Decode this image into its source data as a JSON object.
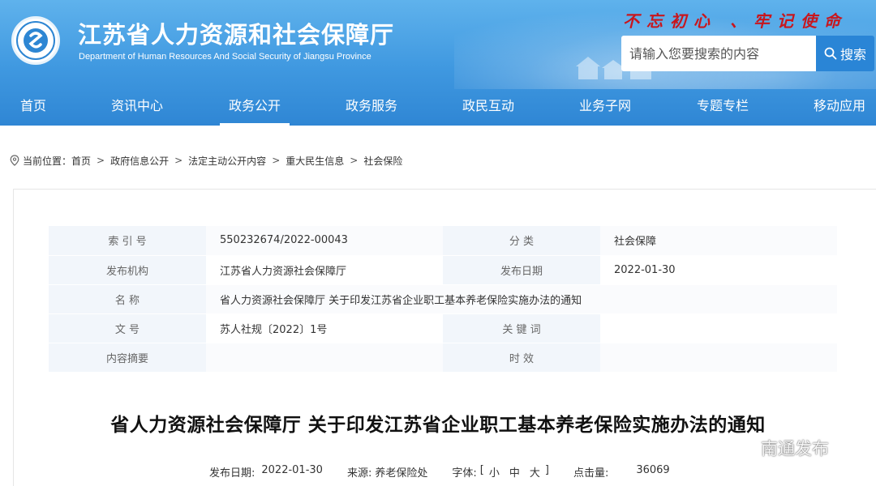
{
  "header": {
    "site_title": "江苏省人力资源和社会保障厅",
    "site_subtitle": "Department of Human Resources And Social Security of Jiangsu Province",
    "slogan": "不忘初心 、牢记使命",
    "search_placeholder": "请输入您要搜索的内容",
    "search_button": "搜索"
  },
  "nav": {
    "items": [
      "首页",
      "资讯中心",
      "政务公开",
      "政务服务",
      "政民互动",
      "业务子网",
      "专题专栏",
      "移动应用"
    ],
    "active": "政务公开"
  },
  "breadcrumb": {
    "prefix": "当前位置：",
    "items": [
      "首页",
      "政府信息公开",
      "法定主动公开内容",
      "重大民生信息",
      "社会保险"
    ]
  },
  "meta": {
    "index_label": "索 引 号",
    "index_value": "550232674/2022-00043",
    "category_label": "分 类",
    "category_value": "社会保障",
    "org_label": "发布机构",
    "org_value": "江苏省人力资源社会保障厅",
    "date_label": "发布日期",
    "date_value": "2022-01-30",
    "name_label": "名 称",
    "name_value": "省人力资源社会保障厅 关于印发江苏省企业职工基本养老保险实施办法的通知",
    "doc_label": "文 号",
    "doc_value": "苏人社规〔2022〕1号",
    "keywords_label": "关 键 词",
    "keywords_value": "",
    "abstract_label": "内容摘要",
    "abstract_value": "",
    "validity_label": "时 效",
    "validity_value": ""
  },
  "article": {
    "title": "省人力资源社会保障厅 关于印发江苏省企业职工基本养老保险实施办法的通知",
    "publish_label": "发布日期:",
    "publish_date": "2022-01-30",
    "source_label": "来源:",
    "source": "养老保险处",
    "font_label": "字体:",
    "font_open": "[",
    "font_small": "小",
    "font_medium": "中",
    "font_large": "大",
    "font_close": "]",
    "hits_label": "点击量:",
    "hits": "36069"
  },
  "watermark": {
    "text": "南通发布"
  },
  "colors": {
    "header_blue": "#3f98e0",
    "slogan_red": "#c8161d",
    "search_button": "#2a85d6",
    "label_bg": "#f2f6fb"
  }
}
